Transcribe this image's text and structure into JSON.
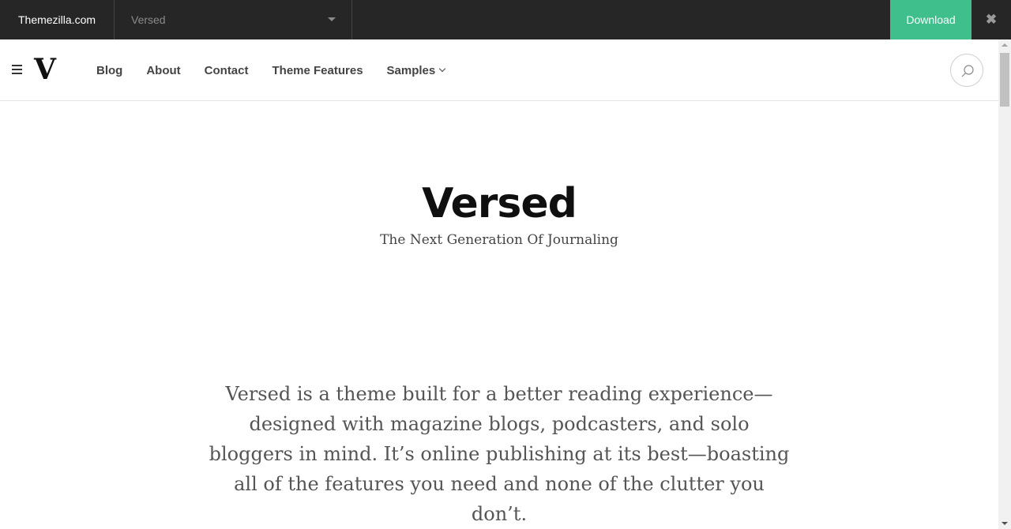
{
  "preview_bar": {
    "brand": "Themezilla.com",
    "theme_select": "Versed",
    "download_label": "Download",
    "close_symbol": "✖",
    "accent_color": "#3ebf8b",
    "bar_color": "#262626"
  },
  "site": {
    "logo": "V",
    "nav": [
      {
        "label": "Blog"
      },
      {
        "label": "About"
      },
      {
        "label": "Contact"
      },
      {
        "label": "Theme Features"
      },
      {
        "label": "Samples"
      }
    ],
    "menu_icon": "hamburger-icon",
    "search_icon": "search-icon"
  },
  "hero": {
    "title": "Versed",
    "subtitle": "The Next Generation Of Journaling"
  },
  "intro": {
    "text": "Versed is a theme built for a better reading experience—designed with magazine blogs, podcasters, and solo bloggers in mind. It’s online publishing at its best—boasting all of the features you need and none of the clutter you don’t."
  }
}
